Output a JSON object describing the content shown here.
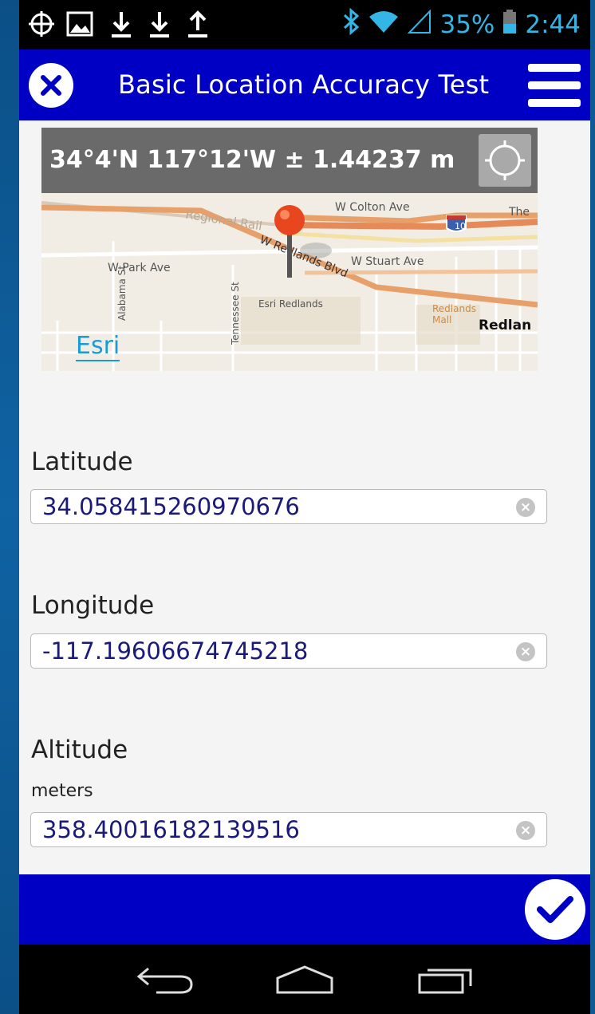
{
  "status_bar": {
    "battery_percent": "35%",
    "time": "2:44",
    "icons": [
      "gps-icon",
      "image-icon",
      "download-icon",
      "download-icon",
      "upload-icon",
      "bluetooth-icon",
      "wifi-icon",
      "signal-icon",
      "battery-icon"
    ]
  },
  "app_bar": {
    "title": "Basic Location Accuracy Test",
    "close_icon": "close-icon",
    "menu_icon": "hamburger-menu-icon"
  },
  "map": {
    "coordinate_readout": "34°4'N 117°12'W ± 1.44237 m",
    "locate_icon": "crosshair-icon",
    "attribution_logo": "Esri",
    "labels": {
      "colton": "W Colton Ave",
      "park": "W Park Ave",
      "stuart": "W Stuart Ave",
      "redlands_blvd": "W Redlands Blvd",
      "esri_redlands": "Esri Redlands",
      "redlands_mall": "Redlands Mall",
      "redlan": "Redlan",
      "the": "The",
      "rail": "Regional Rail",
      "alabama": "Alabama St",
      "tennessee": "Tennessee St",
      "interstate": "10"
    }
  },
  "fields": {
    "latitude": {
      "label": "Latitude",
      "value": "34.058415260970676"
    },
    "longitude": {
      "label": "Longitude",
      "value": "-117.19606674745218"
    },
    "altitude": {
      "label": "Altitude",
      "unit": "meters",
      "value": "358.40016182139516"
    }
  },
  "action_bar": {
    "confirm_icon": "checkmark-icon"
  },
  "nav_bar": {
    "icons": [
      "back-icon",
      "home-icon",
      "recents-icon"
    ]
  },
  "colors": {
    "app_bar": "#0000c4",
    "value_text": "#1a1a7a",
    "status_accent": "#33b5e5"
  }
}
